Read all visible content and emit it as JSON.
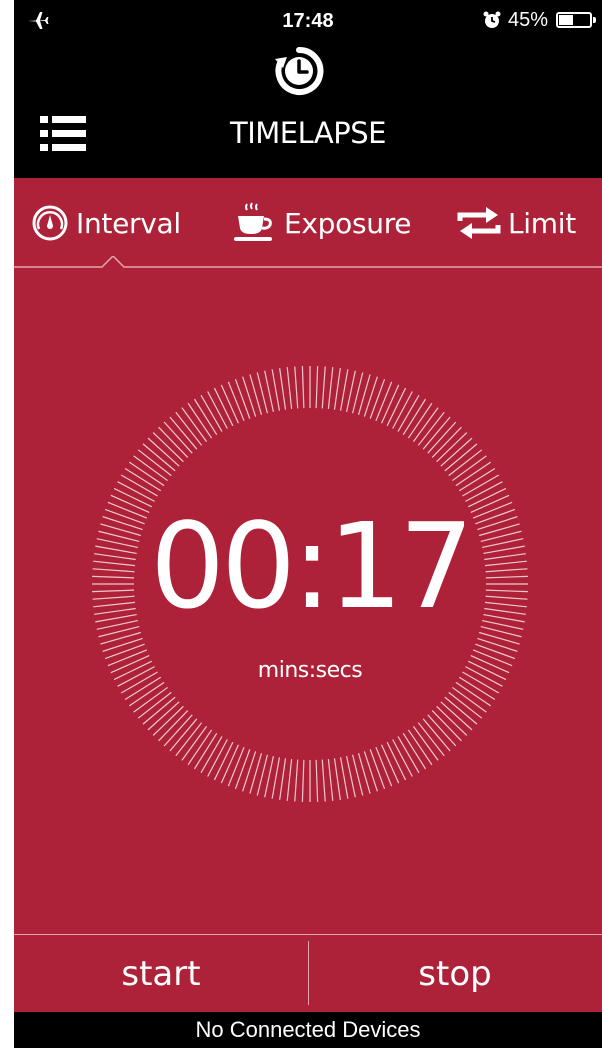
{
  "status_bar": {
    "time": "17:48",
    "battery_percent": "45%",
    "battery_level": 0.45,
    "icons": [
      "airplane-icon",
      "alarm-icon",
      "battery-icon"
    ]
  },
  "header": {
    "title": "TIMELAPSE",
    "logo_icon": "timelapse-clock-icon",
    "menu_icon": "list-menu-icon"
  },
  "tabs": [
    {
      "label": "Interval",
      "icon": "gauge-icon",
      "selected": true
    },
    {
      "label": "Exposure",
      "icon": "coffee-cup-icon",
      "selected": false
    },
    {
      "label": "Limit",
      "icon": "repeat-icon",
      "selected": false
    }
  ],
  "timer": {
    "value": "00:17",
    "unit": "mins:secs"
  },
  "controls": {
    "start_label": "start",
    "stop_label": "stop"
  },
  "footer": {
    "status": "No Connected Devices"
  },
  "colors": {
    "accent": "#ad2238",
    "background": "#000000",
    "text": "#ffffff"
  }
}
